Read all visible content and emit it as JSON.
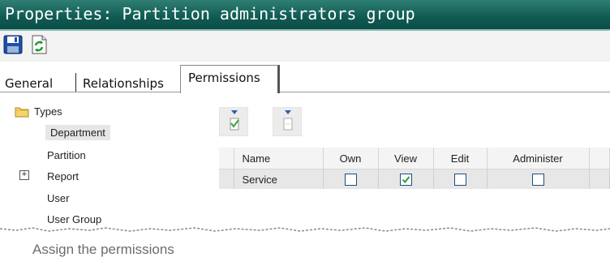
{
  "window": {
    "title": "Properties: Partition administrators group"
  },
  "toolbar": {
    "save_icon": "save-icon",
    "refresh_icon": "refresh-icon"
  },
  "tabs": [
    {
      "label": "General",
      "active": false
    },
    {
      "label": "Relationships",
      "active": false
    },
    {
      "label": "Permissions",
      "active": true
    }
  ],
  "tree": {
    "root": {
      "label": "Types",
      "icon": "folder-icon"
    },
    "items": [
      {
        "label": "Department",
        "selected": true,
        "expandable": false
      },
      {
        "label": "Partition",
        "selected": false,
        "expandable": false
      },
      {
        "label": "Report",
        "selected": false,
        "expandable": true
      },
      {
        "label": "User",
        "selected": false,
        "expandable": false
      },
      {
        "label": "User Group",
        "selected": false,
        "expandable": false
      }
    ]
  },
  "permissions": {
    "columns": [
      "Name",
      "Own",
      "View",
      "Edit",
      "Administer"
    ],
    "rows": [
      {
        "name": "Service",
        "own": false,
        "view": true,
        "edit": false,
        "administer": false
      }
    ]
  },
  "caption": "Assign the permissions",
  "colors": {
    "title_bar": "#0f5a52",
    "checkbox_border": "#1c4f7d",
    "check": "#2f9a2f"
  }
}
